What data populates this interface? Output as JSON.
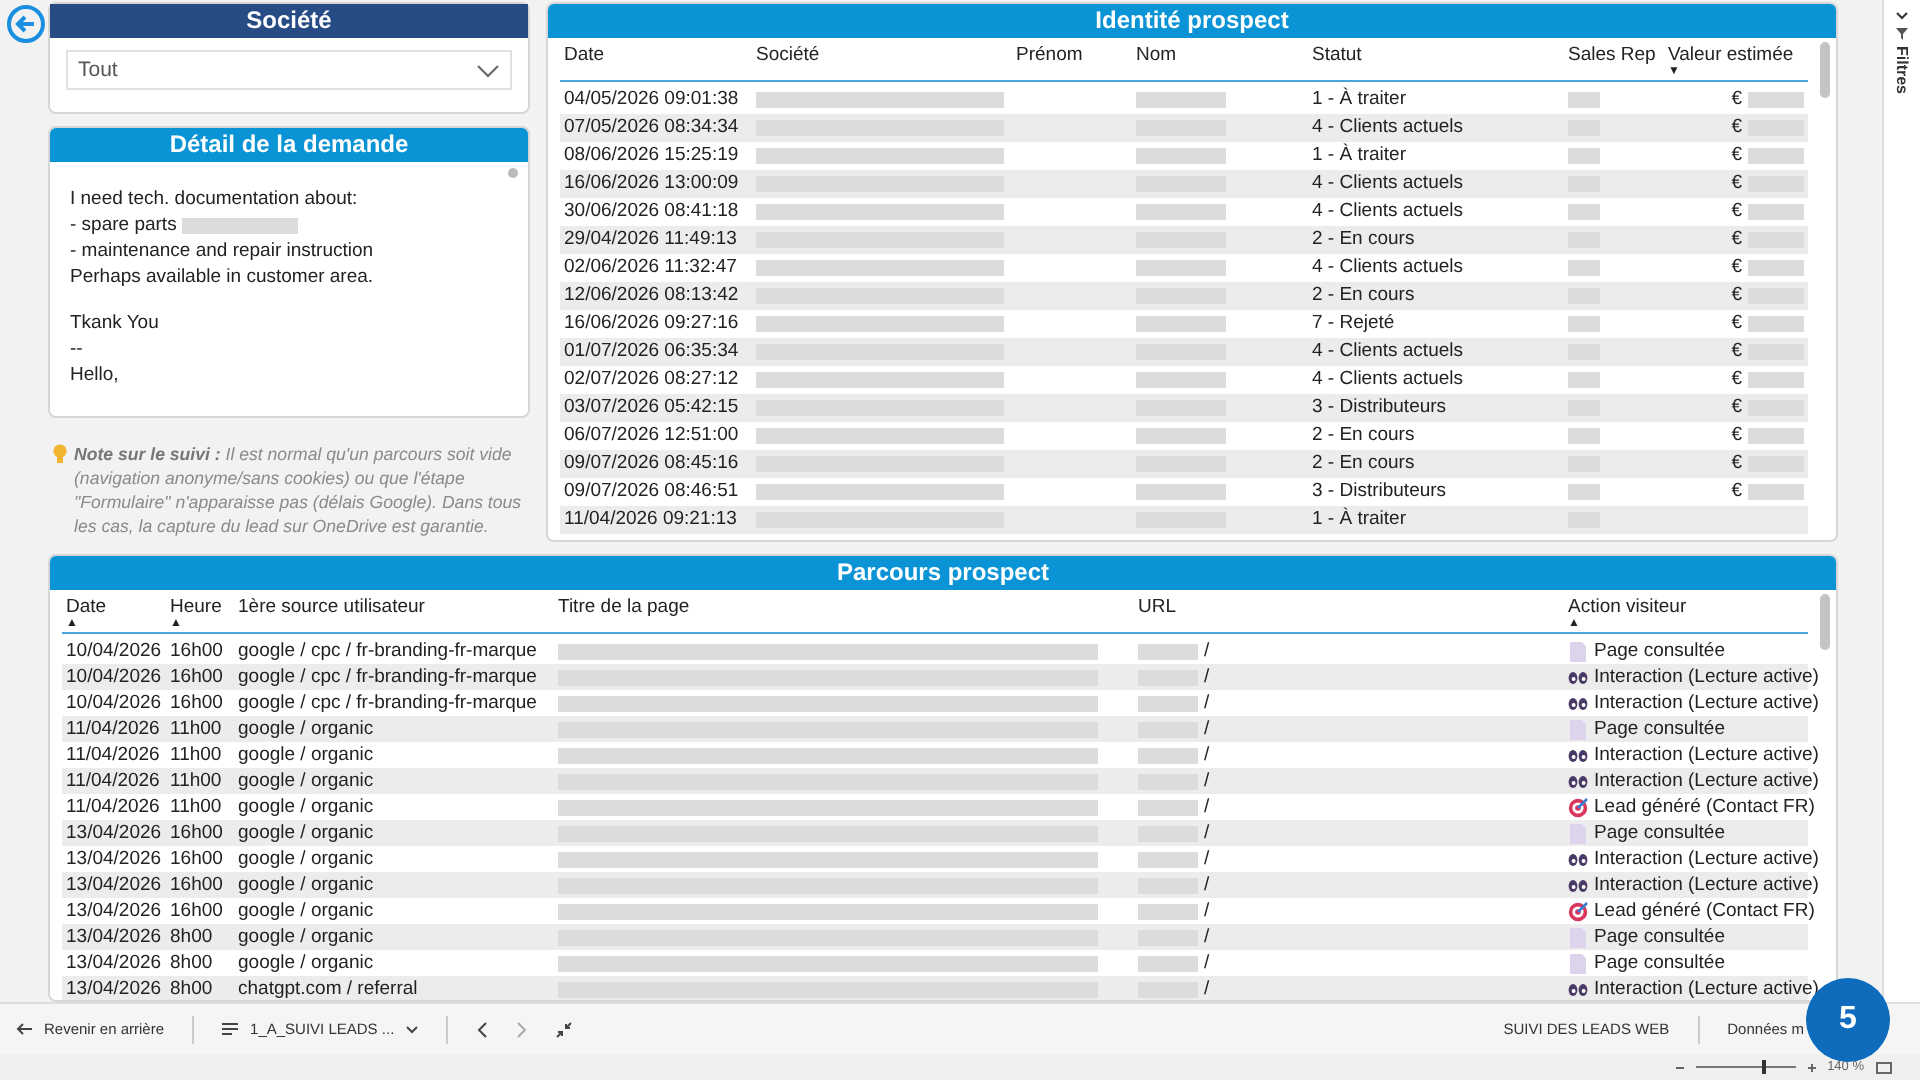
{
  "societe_filter": {
    "title": "Société",
    "value": "Tout"
  },
  "detail": {
    "title": "Détail de la demande",
    "paragraphs": [
      [
        {
          "text": "I need tech. documentation about:"
        },
        {
          "text": "- spare parts",
          "redacted": true
        },
        {
          "text": "- maintenance and repair instruction"
        },
        {
          "text": "Perhaps available in customer area."
        }
      ],
      [
        {
          "text": "Tkank You"
        },
        {
          "text": "--"
        },
        {
          "text": "Hello,"
        }
      ]
    ]
  },
  "note": "**Note sur le suivi :** Il est normal qu'un parcours soit vide (navigation anonyme/sans cookies) ou que l'étape \"Formulaire\" n'apparaisse pas (délais Google). Dans tous les cas, la capture du lead sur OneDrive est garantie.",
  "identite": {
    "title": "Identité prospect",
    "columns": [
      {
        "label": "Date"
      },
      {
        "label": "Société"
      },
      {
        "label": "Prénom"
      },
      {
        "label": "Nom"
      },
      {
        "label": "Statut"
      },
      {
        "label": "Sales Rep"
      },
      {
        "label": "Valeur estimée",
        "sort_arrow": "▼"
      }
    ],
    "rows": [
      {
        "date": "04/05/2026 09:01:38",
        "statut": "1 - À traiter",
        "valeur": "€"
      },
      {
        "date": "07/05/2026 08:34:34",
        "statut": "4 - Clients actuels",
        "valeur": "€"
      },
      {
        "date": "08/06/2026 15:25:19",
        "statut": "1 - À traiter",
        "valeur": "€"
      },
      {
        "date": "16/06/2026 13:00:09",
        "statut": "4 - Clients actuels",
        "valeur": "€"
      },
      {
        "date": "30/06/2026 08:41:18",
        "statut": "4 - Clients actuels",
        "valeur": "€"
      },
      {
        "date": "29/04/2026 11:49:13",
        "statut": "2 - En cours",
        "valeur": "€"
      },
      {
        "date": "02/06/2026 11:32:47",
        "statut": "4 - Clients actuels",
        "valeur": "€"
      },
      {
        "date": "12/06/2026 08:13:42",
        "statut": "2 - En cours",
        "valeur": "€"
      },
      {
        "date": "16/06/2026 09:27:16",
        "statut": "7 - Rejeté",
        "valeur": "€"
      },
      {
        "date": "01/07/2026 06:35:34",
        "statut": "4 - Clients actuels",
        "valeur": "€"
      },
      {
        "date": "02/07/2026 08:27:12",
        "statut": "4 - Clients actuels",
        "valeur": "€"
      },
      {
        "date": "03/07/2026 05:42:15",
        "statut": "3 - Distributeurs",
        "valeur": "€"
      },
      {
        "date": "06/07/2026 12:51:00",
        "statut": "2 - En cours",
        "valeur": "€"
      },
      {
        "date": "09/07/2026 08:45:16",
        "statut": "2 - En cours",
        "valeur": "€"
      },
      {
        "date": "09/07/2026 08:46:51",
        "statut": "3 - Distributeurs",
        "valeur": "€"
      },
      {
        "date": "11/04/2026 09:21:13",
        "statut": "1 - À traiter"
      }
    ]
  },
  "parcours": {
    "title": "Parcours prospect",
    "columns": [
      {
        "label": "Date",
        "sort_arrow": "▲"
      },
      {
        "label": "Heure",
        "sort_arrow": "▲"
      },
      {
        "label": "1ère source utilisateur"
      },
      {
        "label": "Titre de la page"
      },
      {
        "label": "URL"
      },
      {
        "label": "Action visiteur",
        "sort_arrow": "▲"
      }
    ],
    "rows": [
      {
        "date": "10/04/2026",
        "heure": "16h00",
        "source": "google / cpc / fr-branding-fr-marque",
        "url": "/",
        "action": {
          "kind": "page",
          "label": "Page consultée"
        }
      },
      {
        "date": "10/04/2026",
        "heure": "16h00",
        "source": "google / cpc / fr-branding-fr-marque",
        "url": "/",
        "action": {
          "kind": "interaction",
          "label": "Interaction (Lecture active)"
        }
      },
      {
        "date": "10/04/2026",
        "heure": "16h00",
        "source": "google / cpc / fr-branding-fr-marque",
        "url": "/",
        "action": {
          "kind": "interaction",
          "label": "Interaction (Lecture active)"
        }
      },
      {
        "date": "11/04/2026",
        "heure": "11h00",
        "source": "google / organic",
        "url": "/",
        "action": {
          "kind": "page",
          "label": "Page consultée"
        }
      },
      {
        "date": "11/04/2026",
        "heure": "11h00",
        "source": "google / organic",
        "url": "/",
        "action": {
          "kind": "interaction",
          "label": "Interaction (Lecture active)"
        }
      },
      {
        "date": "11/04/2026",
        "heure": "11h00",
        "source": "google / organic",
        "url": "/",
        "action": {
          "kind": "interaction",
          "label": "Interaction (Lecture active)"
        }
      },
      {
        "date": "11/04/2026",
        "heure": "11h00",
        "source": "google / organic",
        "url": "/",
        "action": {
          "kind": "lead",
          "label": "Lead généré (Contact FR)"
        }
      },
      {
        "date": "13/04/2026",
        "heure": "16h00",
        "source": "google / organic",
        "url": "/",
        "action": {
          "kind": "page",
          "label": "Page consultée"
        }
      },
      {
        "date": "13/04/2026",
        "heure": "16h00",
        "source": "google / organic",
        "url": "/",
        "action": {
          "kind": "interaction",
          "label": "Interaction (Lecture active)"
        }
      },
      {
        "date": "13/04/2026",
        "heure": "16h00",
        "source": "google / organic",
        "url": "/",
        "action": {
          "kind": "interaction",
          "label": "Interaction (Lecture active)"
        }
      },
      {
        "date": "13/04/2026",
        "heure": "16h00",
        "source": "google / organic",
        "url": "/",
        "action": {
          "kind": "lead",
          "label": "Lead généré (Contact FR)"
        }
      },
      {
        "date": "13/04/2026",
        "heure": "8h00",
        "source": "google / organic",
        "url": "/",
        "action": {
          "kind": "page",
          "label": "Page consultée"
        }
      },
      {
        "date": "13/04/2026",
        "heure": "8h00",
        "source": "google / organic",
        "url": "/",
        "action": {
          "kind": "page",
          "label": "Page consultée"
        }
      },
      {
        "date": "13/04/2026",
        "heure": "8h00",
        "source": "chatgpt.com / referral",
        "url": "/",
        "action": {
          "kind": "interaction",
          "label": "Interaction (Lecture active)"
        }
      }
    ]
  },
  "filters_pane": {
    "label": "Filtres"
  },
  "bottom_bar": {
    "back": "Revenir en arrière",
    "page_menu": "1_A_SUIVI LEADS ...",
    "report": "SUIVI DES LEADS WEB",
    "data": "Données m",
    "badge": "5",
    "zoom_slider": {
      "level": 0.7
    },
    "zoom": "140 %"
  }
}
